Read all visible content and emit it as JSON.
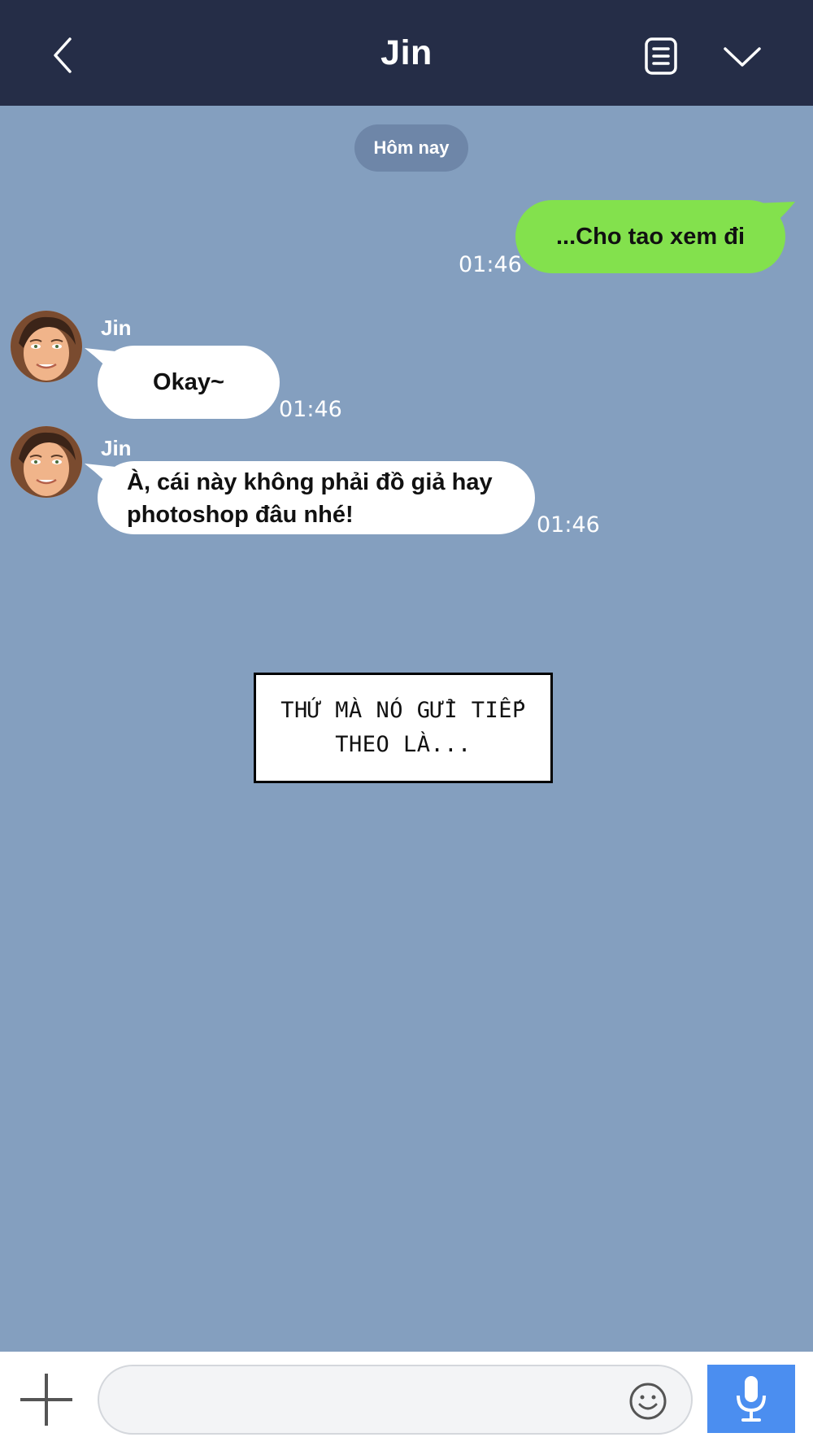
{
  "header": {
    "title": "Jin",
    "icons": [
      "back-chevron-icon",
      "notes-icon",
      "chevron-down-icon"
    ]
  },
  "colors": {
    "header_bg": "#252d47",
    "chat_bg": "#849fbf",
    "my_bubble": "#83e14d",
    "their_bubble": "#ffffff",
    "mic_button": "#4b8ef0"
  },
  "chat": {
    "date_label": "Hôm nay",
    "messages": [
      {
        "from": "me",
        "text": "...Cho tao xem đi",
        "time": "01:46"
      },
      {
        "from": "Jin",
        "sender": "Jin",
        "text": "Okay~",
        "time": "01:46"
      },
      {
        "from": "Jin",
        "sender": "Jin",
        "text_lines": [
          "À, cái này không phải đồ giả hay",
          "photoshop đâu nhé!"
        ],
        "time": "01:46"
      }
    ]
  },
  "caption": {
    "lines": [
      "THỨ MÀ NÓ GỬI TIẾP",
      "THEO LÀ..."
    ]
  },
  "input_bar": {
    "message_value": "",
    "icons": [
      "plus-icon",
      "emoji-icon",
      "microphone-icon"
    ]
  }
}
